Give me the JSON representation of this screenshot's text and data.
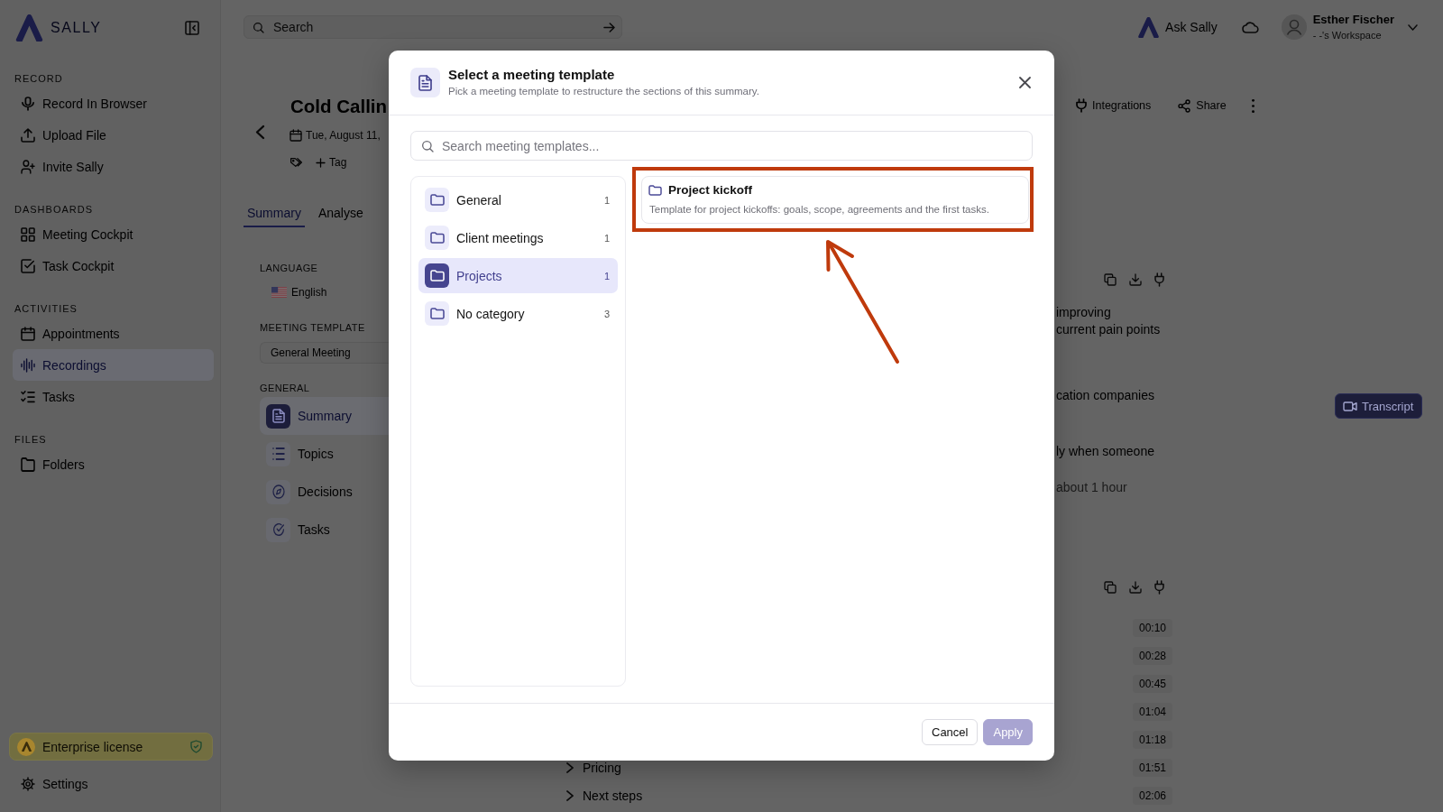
{
  "sidebar": {
    "logo": "SALLY",
    "sections": [
      {
        "title": "RECORD",
        "items": [
          {
            "label": "Record In Browser",
            "selected": false
          },
          {
            "label": "Upload File",
            "selected": false
          },
          {
            "label": "Invite Sally",
            "selected": false
          }
        ]
      },
      {
        "title": "DASHBOARDS",
        "items": [
          {
            "label": "Meeting Cockpit",
            "selected": false
          },
          {
            "label": "Task Cockpit",
            "selected": false
          }
        ]
      },
      {
        "title": "ACTIVITIES",
        "items": [
          {
            "label": "Appointments",
            "selected": false
          },
          {
            "label": "Recordings",
            "selected": true
          },
          {
            "label": "Tasks",
            "selected": false
          }
        ]
      },
      {
        "title": "FILES",
        "items": [
          {
            "label": "Folders",
            "selected": false
          }
        ]
      }
    ],
    "license": "Enterprise license",
    "settings": "Settings"
  },
  "topbar": {
    "search": {
      "placeholder": "Search"
    },
    "assistant": "Ask Sally",
    "user": {
      "name": "Esther Fischer",
      "workspace": "- -'s Workspace"
    }
  },
  "meeting": {
    "title": "Cold Callin",
    "date": "Tue, August 11,",
    "tag": "Tag",
    "actions": [
      {
        "kind": "integrations",
        "label": "Integrations"
      },
      {
        "kind": "share",
        "label": "Share"
      },
      {
        "kind": "more"
      }
    ],
    "tabs": [
      {
        "label": "Summary",
        "selected": true
      },
      {
        "label": "Analyse",
        "selected": false
      }
    ],
    "language": {
      "heading": "LANGUAGE",
      "value": "English"
    },
    "template": {
      "heading": "MEETING TEMPLATE",
      "value": "General Meeting"
    },
    "sections": {
      "heading": "GENERAL",
      "items": [
        {
          "label": "Summary",
          "selected": true
        },
        {
          "label": "Topics",
          "selected": false
        },
        {
          "label": "Decisions",
          "selected": false
        },
        {
          "label": "Tasks",
          "selected": false
        }
      ]
    },
    "summary": [
      {
        "lines": [
          "improving",
          "current pain points"
        ],
        "muted": false
      },
      {
        "lines": [
          "cation companies"
        ],
        "muted": false
      },
      {
        "lines": [
          "ly when someone"
        ],
        "muted": false
      },
      {
        "lines": [
          "about 1 hour"
        ],
        "muted": true
      }
    ],
    "chapters": [
      {
        "time": "00:10"
      },
      {
        "time": "00:28"
      },
      {
        "time": "00:45"
      },
      {
        "time": "01:04"
      },
      {
        "time": "01:18"
      },
      {
        "title": "Pricing",
        "time": "01:51",
        "expanded": false
      },
      {
        "title": "Next steps",
        "time": "02:06",
        "expanded": false
      }
    ],
    "transcript_button": "Transcript"
  },
  "modal": {
    "title": "Select a meeting template",
    "subtitle": "Pick a meeting template to restructure the sections of this summary.",
    "search": {
      "placeholder": "Search meeting templates..."
    },
    "categories": [
      {
        "label": "General",
        "count": "1",
        "selected": false
      },
      {
        "label": "Client meetings",
        "count": "1",
        "selected": false
      },
      {
        "label": "Projects",
        "count": "1",
        "selected": true
      },
      {
        "label": "No category",
        "count": "3",
        "selected": false
      }
    ],
    "templates": [
      {
        "title": "Project kickoff",
        "description": "Template for project kickoffs: goals, scope, agreements and the first tasks."
      }
    ],
    "buttons": [
      {
        "label": "Cancel",
        "kind": "secondary",
        "disabled": false
      },
      {
        "label": "Apply",
        "kind": "primary",
        "disabled": true
      }
    ]
  }
}
